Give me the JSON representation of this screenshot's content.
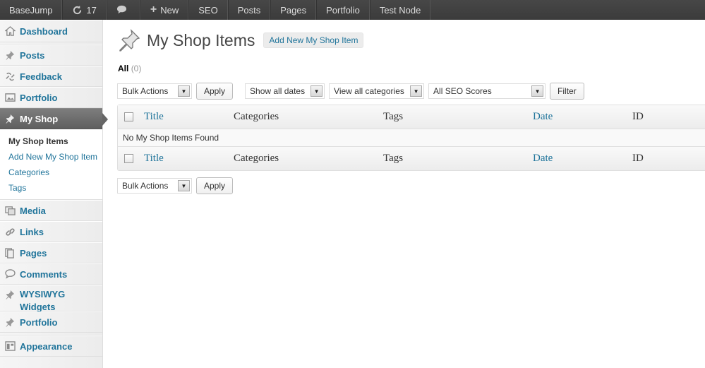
{
  "admin_bar": {
    "site": "BaseJump",
    "updates": "17",
    "new": "New",
    "items": [
      "SEO",
      "Posts",
      "Pages",
      "Portfolio",
      "Test Node"
    ]
  },
  "sidebar": {
    "dashboard": "Dashboard",
    "posts": "Posts",
    "feedback": "Feedback",
    "portfolio": "Portfolio",
    "my_shop": "My Shop",
    "submenu": [
      "My Shop Items",
      "Add New My Shop Item",
      "Categories",
      "Tags"
    ],
    "media": "Media",
    "links": "Links",
    "pages": "Pages",
    "comments": "Comments",
    "wysiwyg_line1": "WYSIWYG",
    "wysiwyg_line2": "Widgets",
    "portfolio2": "Portfolio",
    "appearance": "Appearance"
  },
  "page": {
    "title": "My Shop Items",
    "add_new": "Add New My Shop Item",
    "filter_all": "All",
    "filter_count": "(0)"
  },
  "tablenav_top": {
    "bulk_actions": "Bulk Actions",
    "apply": "Apply",
    "dates": "Show all dates",
    "categories": "View all categories",
    "seo": "All SEO Scores",
    "filter": "Filter"
  },
  "table": {
    "columns": {
      "title": "Title",
      "categories": "Categories",
      "tags": "Tags",
      "date": "Date",
      "id": "ID"
    },
    "empty_message": "No My Shop Items Found"
  },
  "tablenav_bottom": {
    "bulk_actions": "Bulk Actions",
    "apply": "Apply"
  },
  "colors": {
    "link": "#21759b",
    "admin_bar": "#464646",
    "active_menu": "#6d6d6d"
  }
}
